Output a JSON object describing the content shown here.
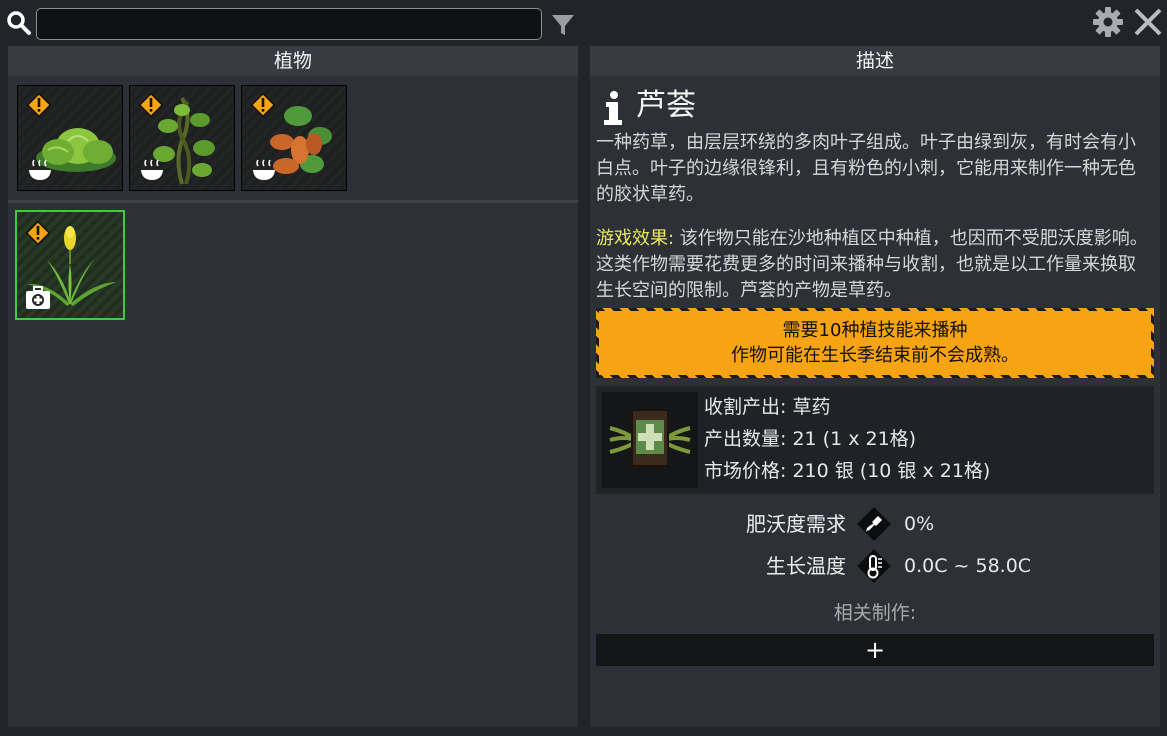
{
  "search": {
    "value": "",
    "placeholder": ""
  },
  "left_panel": {
    "header": "植物",
    "plants": [
      {
        "icon": "cabbage-plant-icon",
        "status": "warning",
        "type": "food"
      },
      {
        "icon": "climbing-vine-plant-icon",
        "status": "warning",
        "type": "food"
      },
      {
        "icon": "sweet-potato-plant-icon",
        "status": "warning",
        "type": "food"
      },
      {
        "icon": "aloe-plant-icon",
        "status": "warning",
        "type": "medicine",
        "selected": true
      }
    ]
  },
  "right_panel": {
    "header": "描述",
    "plant_name": "芦荟",
    "description": "一种药草，由层层环绕的多肉叶子组成。叶子由绿到灰，有时会有小白点。叶子的边缘很锋利，且有粉色的小刺，它能用来制作一种无色的胶状草药。",
    "effect_label": "游戏效果:",
    "effect_text": " 该作物只能在沙地种植区中种植，也因而不受肥沃度影响。这类作物需要花费更多的时间来播种与收割，也就是以工作量来换取生长空间的限制。芦荟的产物是草药。",
    "warning_line1": "需要10种植技能来播种",
    "warning_line2": "作物可能在生长季结束前不会成熟。",
    "yield": {
      "line1": "收割产出: 草药",
      "line2": "产出数量: 21 (1 x 21格)",
      "line3": "市场价格: 210 银 (10 银 x 21格)"
    },
    "stats": [
      {
        "label": "肥沃度需求",
        "value": "0%",
        "icon": "trowel-icon"
      },
      {
        "label": "生长温度",
        "value": "0.0C ~ 58.0C",
        "icon": "thermometer-icon"
      }
    ],
    "related_label": "相关制作:",
    "add_label": "+"
  },
  "colors": {
    "accent_warning": "#f6a414",
    "selected_border": "#3ecb3e",
    "effect_label": "#e8e85a"
  }
}
